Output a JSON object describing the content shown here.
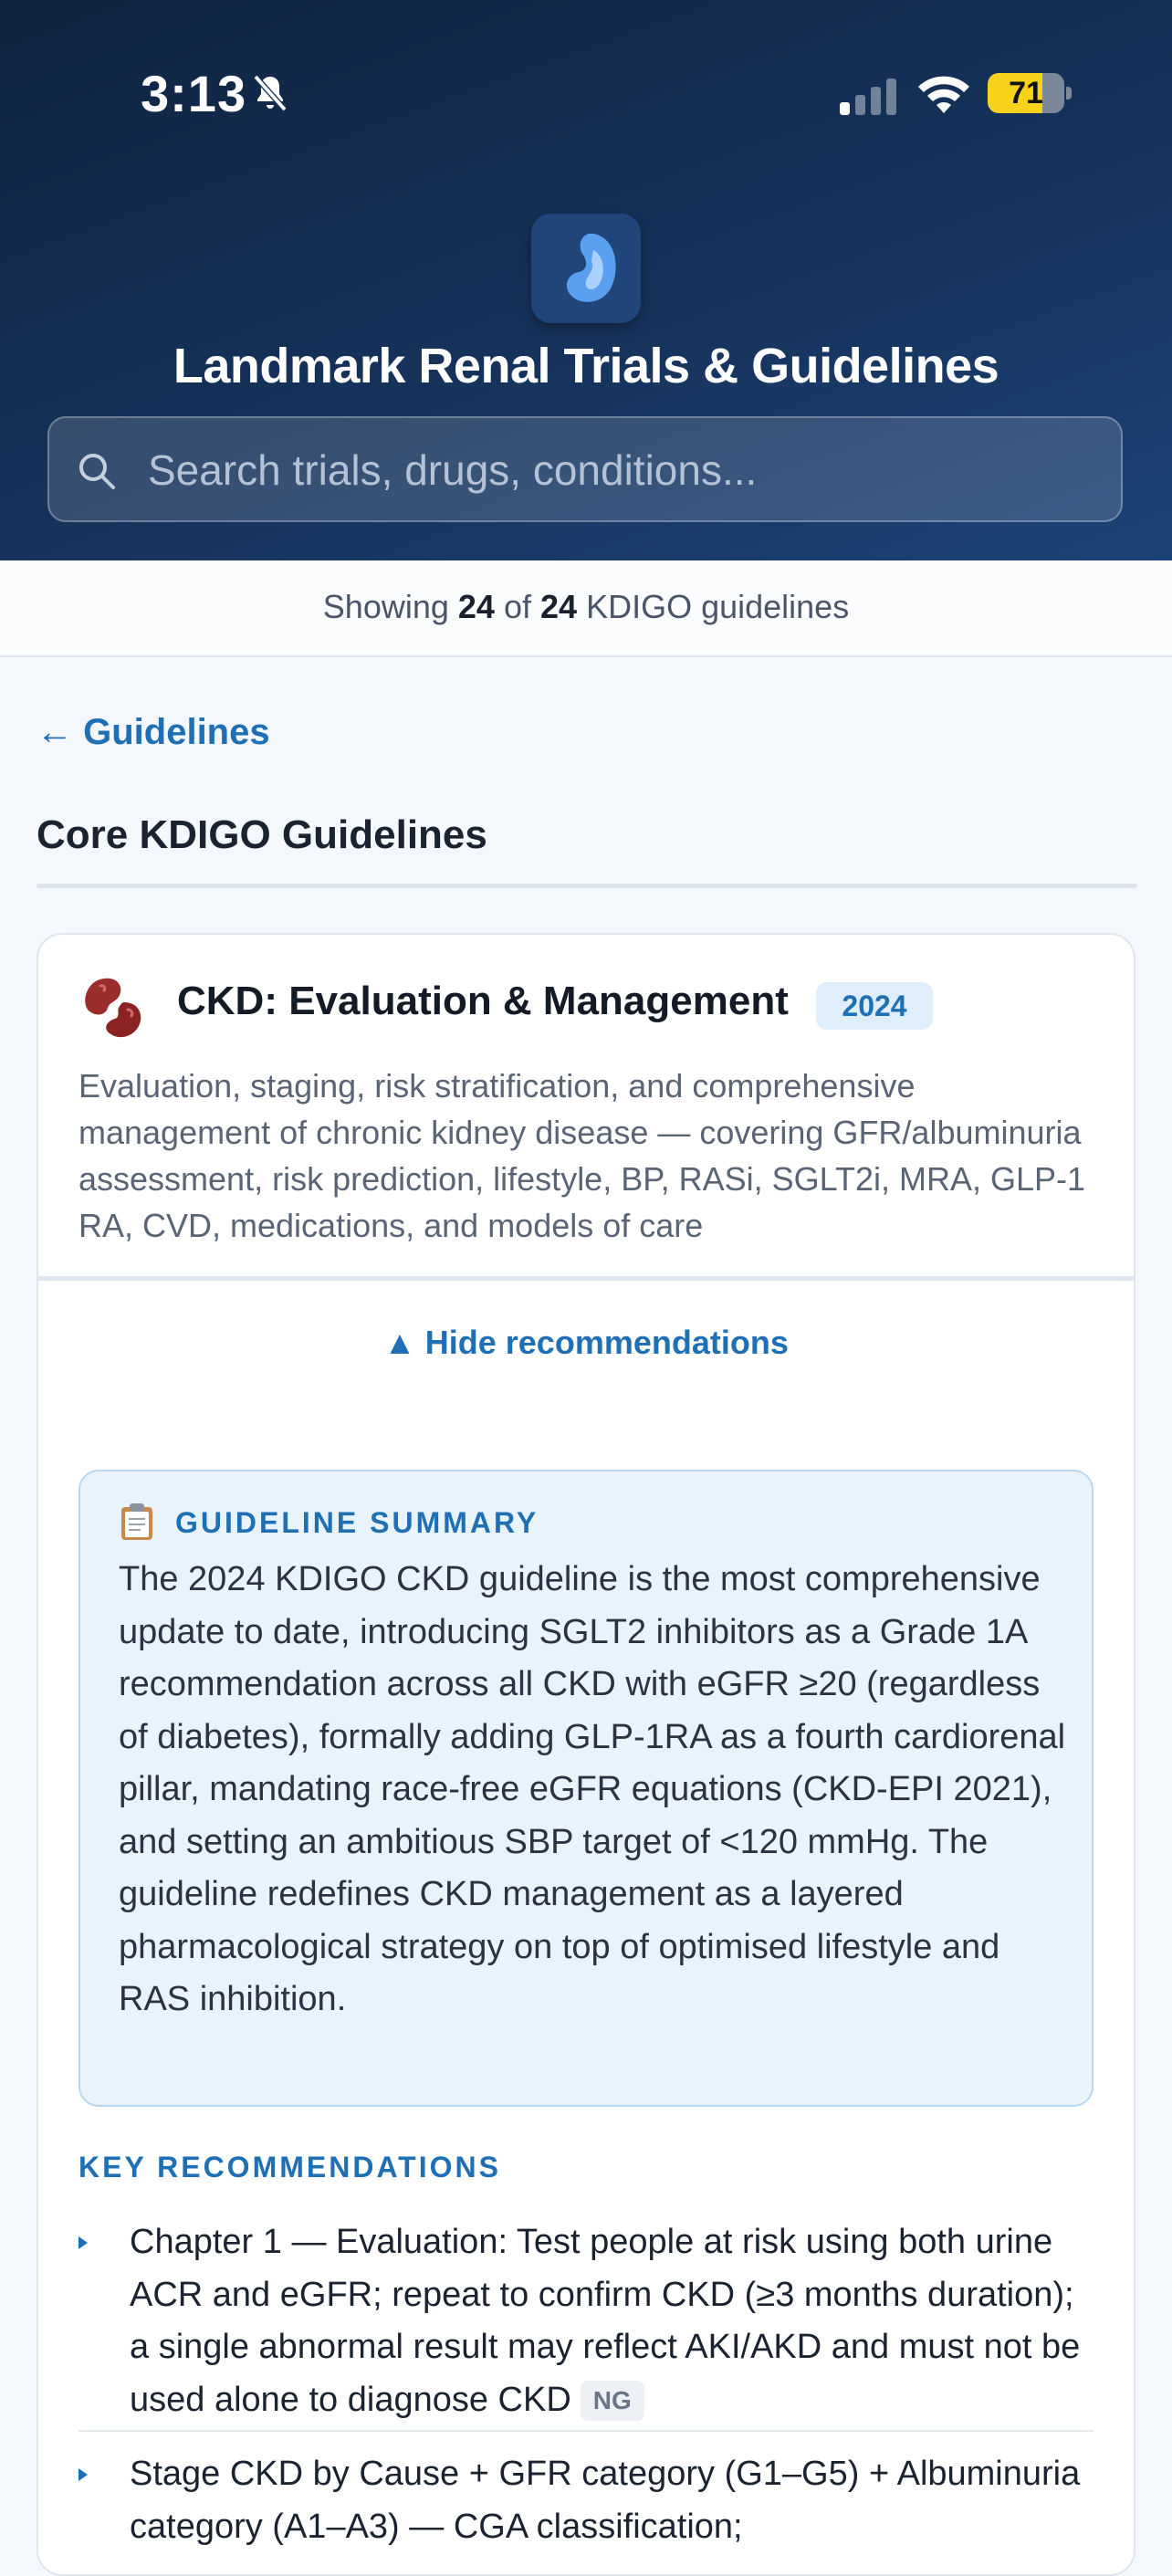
{
  "status": {
    "time": "3:13",
    "battery": "71",
    "battery_level": 0.71
  },
  "header": {
    "title": "Landmark Renal Trials & Guidelines",
    "search_placeholder": "Search trials, drugs, conditions..."
  },
  "results": {
    "prefix": "Showing",
    "shown": "24",
    "of": "of",
    "total": "24",
    "suffix": "KDIGO guidelines"
  },
  "nav": {
    "back_label": "← Guidelines"
  },
  "section": {
    "title": "Core KDIGO Guidelines"
  },
  "card": {
    "title": "CKD: Evaluation & Management",
    "year": "2024",
    "description": "Evaluation, staging, risk stratification, and comprehensive management of chronic kidney disease — covering GFR/albuminuria assessment, risk prediction, lifestyle, BP, RASi, SGLT2i, MRA, GLP-1 RA, CVD, medications, and models of care",
    "toggle_label": "▲ Hide recommendations",
    "summary_heading": "GUIDELINE SUMMARY",
    "summary_body": "The 2024 KDIGO CKD guideline is the most comprehensive update to date, introducing SGLT2 inhibitors as a Grade 1A recommendation across all CKD with eGFR ≥20 (regardless of diabetes), formally adding GLP-1RA as a fourth cardiorenal pillar, mandating race-free eGFR equations (CKD-EPI 2021), and setting an ambitious SBP target of <120 mmHg. The guideline redefines CKD management as a layered pharmacological strategy on top of optimised lifestyle and RAS inhibition.",
    "key_heading": "KEY RECOMMENDATIONS",
    "recommendations": [
      {
        "text": "Chapter 1 — Evaluation: Test people at risk using both urine ACR and eGFR; repeat to confirm CKD (≥3 months duration); a single abnormal result may reflect AKI/AKD and must not be used alone to diagnose CKD",
        "grade": "NG"
      },
      {
        "text": "Stage CKD by Cause + GFR category (G1–G5) + Albuminuria category (A1–A3) — CGA classification;",
        "grade": ""
      }
    ]
  },
  "icons": {
    "bell": "bell-slash-icon",
    "signal": "cellular-signal-icon",
    "wifi": "wifi-icon",
    "search": "search-icon",
    "kidney": "kidney-icon",
    "clipboard": "clipboard-icon"
  }
}
